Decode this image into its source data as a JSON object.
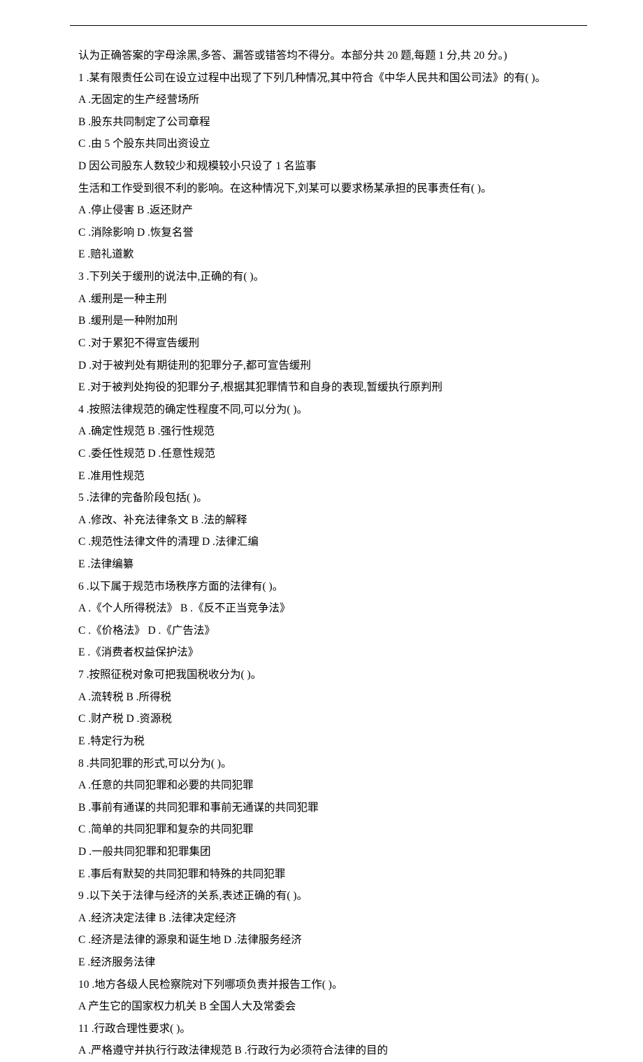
{
  "lines": [
    "认为正确答案的字母涂黑,多答、漏答或错答均不得分。本部分共 20 题,每题 1 分,共 20 分。)",
    "1 .某有限责任公司在设立过程中出现了下列几种情况,其中符合《中华人民共和国公司法》的有( )。",
    "A .无固定的生产经营场所",
    "B .股东共同制定了公司章程",
    "C .由 5 个股东共同出资设立",
    "D 因公司股东人数较少和规模较小只设了 1 名监事",
    "生活和工作受到很不利的影响。在这种情况下,刘某可以要求杨某承担的民事责任有( )。",
    "A .停止侵害 B .返还财产",
    "C .消除影响 D .恢复名誉",
    "E .赔礼道歉",
    "3 .下列关于缓刑的说法中,正确的有( )。",
    "A .缓刑是一种主刑",
    "B .缓刑是一种附加刑",
    "C .对于累犯不得宣告缓刑",
    "D .对于被判处有期徒刑的犯罪分子,都可宣告缓刑",
    "E .对于被判处拘役的犯罪分子,根据其犯罪情节和自身的表现,暂缓执行原判刑",
    "4 .按照法律规范的确定性程度不同,可以分为( )。",
    "A .确定性规范 B .强行性规范",
    "C .委任性规范 D .任意性规范",
    "E .准用性规范",
    "5 .法律的完备阶段包括( )。",
    "A .修改、补充法律条文 B .法的解释",
    "C .规范性法律文件的清理 D .法律汇编",
    "E .法律编纂",
    "6 .以下属于规范市场秩序方面的法律有( )。",
    "A .《个人所得税法》 B .《反不正当竞争法》",
    "C .《价格法》 D .《广告法》",
    "E .《消费者权益保护法》",
    "7 .按照征税对象可把我国税收分为( )。",
    "A .流转税 B .所得税",
    "C .财产税 D .资源税",
    "E .特定行为税",
    "8 .共同犯罪的形式,可以分为( )。",
    "A .任意的共同犯罪和必要的共同犯罪",
    "B .事前有通谋的共同犯罪和事前无通谋的共同犯罪",
    "C .简单的共同犯罪和复杂的共同犯罪",
    "D .一般共同犯罪和犯罪集团",
    "E .事后有默契的共同犯罪和特殊的共同犯罪",
    "9 .以下关于法律与经济的关系,表述正确的有( )。",
    "A .经济决定法律 B .法律决定经济",
    "C .经济是法律的源泉和诞生地 D .法律服务经济",
    "E .经济服务法律",
    "10 .地方各级人民检察院对下列哪项负责并报告工作( )。",
    "A 产生它的国家权力机关 B 全国人大及常委会",
    "11 .行政合理性要求( )。",
    "A .严格遵守并执行行政法律规范 B .行政行为必须符合法律的目的"
  ]
}
